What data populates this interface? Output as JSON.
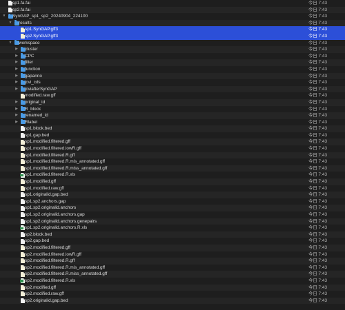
{
  "file_list": {
    "rows": [
      {
        "name": "sp1.fa.fai",
        "date": "今日 7:43",
        "kind": "doc",
        "depth": 0,
        "expanded": null,
        "selected": false
      },
      {
        "name": "sp2.fa.fai",
        "date": "今日 7:43",
        "kind": "doc",
        "depth": 0,
        "expanded": null,
        "selected": false
      },
      {
        "name": "SynGAP_sp1_sp2_20240904_224100",
        "date": "今日 7:43",
        "kind": "folder",
        "depth": 0,
        "expanded": true,
        "selected": false
      },
      {
        "name": "results",
        "date": "今日 7:43",
        "kind": "folder",
        "depth": 1,
        "expanded": true,
        "selected": false
      },
      {
        "name": "sp1.SynGAP.gff3",
        "date": "今日 7:43",
        "kind": "gff",
        "depth": 2,
        "expanded": null,
        "selected": true
      },
      {
        "name": "sp2.SynGAP.gff3",
        "date": "今日 7:43",
        "kind": "gff",
        "depth": 2,
        "expanded": null,
        "selected": true
      },
      {
        "name": "workspace",
        "date": "今日 7:43",
        "kind": "folder",
        "depth": 1,
        "expanded": true,
        "selected": false
      },
      {
        "name": "cluster",
        "date": "今日 7:43",
        "kind": "folder",
        "depth": 2,
        "expanded": false,
        "selected": false
      },
      {
        "name": "CPC",
        "date": "今日 7:43",
        "kind": "folder",
        "depth": 2,
        "expanded": false,
        "selected": false
      },
      {
        "name": "filter",
        "date": "今日 7:43",
        "kind": "folder",
        "depth": 2,
        "expanded": false,
        "selected": false
      },
      {
        "name": "function",
        "date": "今日 7:43",
        "kind": "folder",
        "depth": 2,
        "expanded": false,
        "selected": false
      },
      {
        "name": "gapanno",
        "date": "今日 7:43",
        "kind": "folder",
        "depth": 2,
        "expanded": false,
        "selected": false
      },
      {
        "name": "jcvi_cds",
        "date": "今日 7:43",
        "kind": "folder",
        "depth": 2,
        "expanded": false,
        "selected": false
      },
      {
        "name": "jcviafterSynGAP",
        "date": "今日 7:43",
        "kind": "folder",
        "depth": 2,
        "expanded": false,
        "selected": false
      },
      {
        "name": "modified.raw.gff",
        "date": "今日 7:43",
        "kind": "gff",
        "depth": 2,
        "expanded": null,
        "selected": false
      },
      {
        "name": "original_id",
        "date": "今日 7:43",
        "kind": "folder",
        "depth": 2,
        "expanded": false,
        "selected": false
      },
      {
        "name": "R_block",
        "date": "今日 7:43",
        "kind": "folder",
        "depth": 2,
        "expanded": false,
        "selected": false
      },
      {
        "name": "renamed_id",
        "date": "今日 7:43",
        "kind": "folder",
        "depth": 2,
        "expanded": false,
        "selected": false
      },
      {
        "name": "Rlabel",
        "date": "今日 7:43",
        "kind": "folder",
        "depth": 2,
        "expanded": false,
        "selected": false
      },
      {
        "name": "sp1.block.bed",
        "date": "今日 7:43",
        "kind": "doc",
        "depth": 2,
        "expanded": null,
        "selected": false
      },
      {
        "name": "sp1.gap.bed",
        "date": "今日 7:43",
        "kind": "doc",
        "depth": 2,
        "expanded": null,
        "selected": false
      },
      {
        "name": "sp1.modified.filtered.gff",
        "date": "今日 7:43",
        "kind": "gff",
        "depth": 2,
        "expanded": null,
        "selected": false
      },
      {
        "name": "sp1.modified.filtered.lowR.gff",
        "date": "今日 7:43",
        "kind": "gff",
        "depth": 2,
        "expanded": null,
        "selected": false
      },
      {
        "name": "sp1.modified.filtered.R.gff",
        "date": "今日 7:43",
        "kind": "gff",
        "depth": 2,
        "expanded": null,
        "selected": false
      },
      {
        "name": "sp1.modified.filtered.R.mis_annotated.gff",
        "date": "今日 7:43",
        "kind": "gff",
        "depth": 2,
        "expanded": null,
        "selected": false
      },
      {
        "name": "sp1.modified.filtered.R.miss_annotated.gff",
        "date": "今日 7:43",
        "kind": "gff",
        "depth": 2,
        "expanded": null,
        "selected": false
      },
      {
        "name": "sp1.modified.filtered.R.xls",
        "date": "今日 7:43",
        "kind": "xls",
        "depth": 2,
        "expanded": null,
        "selected": false
      },
      {
        "name": "sp1.modified.gff",
        "date": "今日 7:43",
        "kind": "gff",
        "depth": 2,
        "expanded": null,
        "selected": false
      },
      {
        "name": "sp1.modified.raw.gff",
        "date": "今日 7:43",
        "kind": "gff",
        "depth": 2,
        "expanded": null,
        "selected": false
      },
      {
        "name": "sp1.originalid.gap.bed",
        "date": "今日 7:43",
        "kind": "doc",
        "depth": 2,
        "expanded": null,
        "selected": false
      },
      {
        "name": "sp1.sp2.anchors.gap",
        "date": "今日 7:43",
        "kind": "doc",
        "depth": 2,
        "expanded": null,
        "selected": false
      },
      {
        "name": "sp1.sp2.originalid.anchors",
        "date": "今日 7:43",
        "kind": "doc",
        "depth": 2,
        "expanded": null,
        "selected": false
      },
      {
        "name": "sp1.sp2.originalid.anchors.gap",
        "date": "今日 7:43",
        "kind": "doc",
        "depth": 2,
        "expanded": null,
        "selected": false
      },
      {
        "name": "sp1.sp2.originalid.anchors.genepairs",
        "date": "今日 7:43",
        "kind": "doc",
        "depth": 2,
        "expanded": null,
        "selected": false
      },
      {
        "name": "sp1.sp2.originalid.anchors.R.xls",
        "date": "今日 7:43",
        "kind": "xls",
        "depth": 2,
        "expanded": null,
        "selected": false
      },
      {
        "name": "sp2.block.bed",
        "date": "今日 7:43",
        "kind": "doc",
        "depth": 2,
        "expanded": null,
        "selected": false
      },
      {
        "name": "sp2.gap.bed",
        "date": "今日 7:43",
        "kind": "doc",
        "depth": 2,
        "expanded": null,
        "selected": false
      },
      {
        "name": "sp2.modified.filtered.gff",
        "date": "今日 7:43",
        "kind": "gff",
        "depth": 2,
        "expanded": null,
        "selected": false
      },
      {
        "name": "sp2.modified.filtered.lowR.gff",
        "date": "今日 7:43",
        "kind": "gff",
        "depth": 2,
        "expanded": null,
        "selected": false
      },
      {
        "name": "sp2.modified.filtered.R.gff",
        "date": "今日 7:43",
        "kind": "gff",
        "depth": 2,
        "expanded": null,
        "selected": false
      },
      {
        "name": "sp2.modified.filtered.R.mis_annotated.gff",
        "date": "今日 7:43",
        "kind": "gff",
        "depth": 2,
        "expanded": null,
        "selected": false
      },
      {
        "name": "sp2.modified.filtered.R.miss_annotated.gff",
        "date": "今日 7:43",
        "kind": "gff",
        "depth": 2,
        "expanded": null,
        "selected": false
      },
      {
        "name": "sp2.modified.filtered.R.xls",
        "date": "今日 7:43",
        "kind": "xls",
        "depth": 2,
        "expanded": null,
        "selected": false
      },
      {
        "name": "sp2.modified.gff",
        "date": "今日 7:43",
        "kind": "gff",
        "depth": 2,
        "expanded": null,
        "selected": false
      },
      {
        "name": "sp2.modified.raw.gff",
        "date": "今日 7:43",
        "kind": "gff",
        "depth": 2,
        "expanded": null,
        "selected": false
      },
      {
        "name": "sp2.originalid.gap.bed",
        "date": "今日 7:43",
        "kind": "doc",
        "depth": 2,
        "expanded": null,
        "selected": false
      }
    ]
  },
  "icons": {
    "folder": "folder-icon",
    "doc": "document-icon",
    "gff": "gff-file-icon",
    "xls": "spreadsheet-icon",
    "expanded": "disclosure-down-icon",
    "collapsed": "disclosure-right-icon"
  },
  "colors": {
    "background": "#1e1e1e",
    "row_alt": "#252525",
    "selection": "#2c4fd8",
    "folder": "#4a9be6",
    "text": "#dcdcdc",
    "date_text": "#b7b7b7"
  }
}
